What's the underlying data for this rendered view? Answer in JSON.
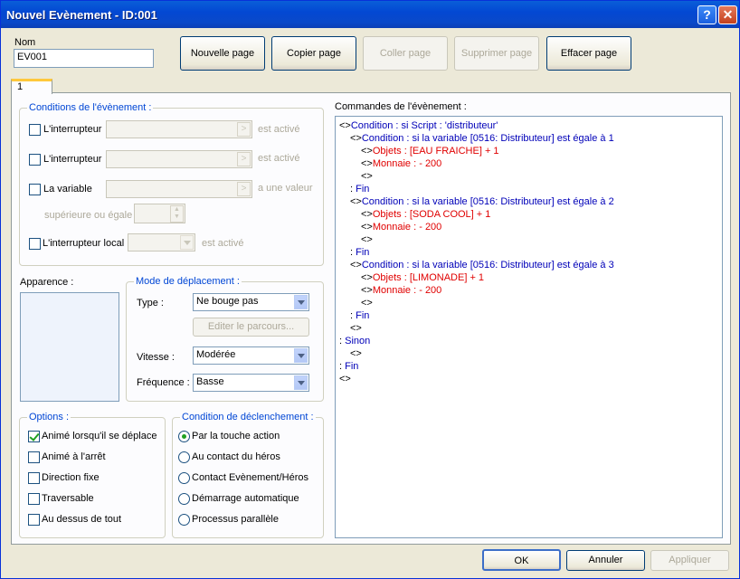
{
  "window": {
    "title": "Nouvel Evènement - ID:001",
    "help_label": "?",
    "close_label": "✕"
  },
  "name": {
    "label": "Nom",
    "value": "EV001"
  },
  "page_buttons": {
    "new_page": "Nouvelle page",
    "copy_page": "Copier page",
    "paste_page": "Coller page",
    "delete_page": "Supprimer page",
    "clear_page": "Effacer page"
  },
  "tabs": [
    {
      "label": "1"
    }
  ],
  "conditions": {
    "legend": "Conditions de l'évènement :",
    "switch1": {
      "label": "L'interrupteur",
      "suffix": "est activé"
    },
    "switch2": {
      "label": "L'interrupteur",
      "suffix": "est activé"
    },
    "variable": {
      "label": "La variable",
      "suffix": "a une valeur",
      "compare": "supérieure ou égale"
    },
    "local_switch": {
      "label": "L'interrupteur local",
      "suffix": "est activé"
    }
  },
  "appearance": {
    "label": "Apparence :"
  },
  "movement": {
    "legend": "Mode de déplacement :",
    "type_label": "Type :",
    "type_value": "Ne bouge pas",
    "edit_route": "Editer le parcours...",
    "speed_label": "Vitesse :",
    "speed_value": "Modérée",
    "freq_label": "Fréquence :",
    "freq_value": "Basse"
  },
  "options": {
    "legend": "Options :",
    "items": [
      {
        "label": "Animé lorsqu'il se déplace",
        "checked": true
      },
      {
        "label": "Animé à l'arrêt",
        "checked": false
      },
      {
        "label": "Direction fixe",
        "checked": false
      },
      {
        "label": "Traversable",
        "checked": false
      },
      {
        "label": "Au dessus de tout",
        "checked": false
      }
    ]
  },
  "trigger": {
    "legend": "Condition de déclenchement :",
    "items": [
      {
        "label": "Par la touche action",
        "selected": true
      },
      {
        "label": "Au contact du héros",
        "selected": false
      },
      {
        "label": "Contact Evènement/Héros",
        "selected": false
      },
      {
        "label": "Démarrage automatique",
        "selected": false
      },
      {
        "label": "Processus parallèle",
        "selected": false
      }
    ]
  },
  "commands": {
    "label": "Commandes de l'évènement :",
    "lines": [
      {
        "indent": 0,
        "prefix": "<>",
        "text": "Condition : si Script : 'distributeur'",
        "color": "blue"
      },
      {
        "indent": 1,
        "prefix": "<>",
        "text": "Condition : si la variable [0516: Distributeur] est égale à 1",
        "color": "blue"
      },
      {
        "indent": 2,
        "prefix": "<>",
        "text": "Objets : [EAU FRAICHE] + 1",
        "color": "red"
      },
      {
        "indent": 2,
        "prefix": "<>",
        "text": "Monnaie : - 200",
        "color": "red"
      },
      {
        "indent": 2,
        "prefix": "<>",
        "text": "",
        "color": "black"
      },
      {
        "indent": 1,
        "prefix": ": ",
        "text": "Fin",
        "color": "blue"
      },
      {
        "indent": 1,
        "prefix": "<>",
        "text": "Condition : si la variable [0516: Distributeur] est égale à 2",
        "color": "blue"
      },
      {
        "indent": 2,
        "prefix": "<>",
        "text": "Objets : [SODA COOL] + 1",
        "color": "red"
      },
      {
        "indent": 2,
        "prefix": "<>",
        "text": "Monnaie : - 200",
        "color": "red"
      },
      {
        "indent": 2,
        "prefix": "<>",
        "text": "",
        "color": "black"
      },
      {
        "indent": 1,
        "prefix": ": ",
        "text": "Fin",
        "color": "blue"
      },
      {
        "indent": 1,
        "prefix": "<>",
        "text": "Condition : si la variable [0516: Distributeur] est égale à 3",
        "color": "blue"
      },
      {
        "indent": 2,
        "prefix": "<>",
        "text": "Objets : [LIMONADE] + 1",
        "color": "red"
      },
      {
        "indent": 2,
        "prefix": "<>",
        "text": "Monnaie : - 200",
        "color": "red"
      },
      {
        "indent": 2,
        "prefix": "<>",
        "text": "",
        "color": "black"
      },
      {
        "indent": 1,
        "prefix": ": ",
        "text": "Fin",
        "color": "blue"
      },
      {
        "indent": 1,
        "prefix": "<>",
        "text": "",
        "color": "black"
      },
      {
        "indent": 0,
        "prefix": ": ",
        "text": "Sinon",
        "color": "blue"
      },
      {
        "indent": 1,
        "prefix": "<>",
        "text": "",
        "color": "black"
      },
      {
        "indent": 0,
        "prefix": ": ",
        "text": "Fin",
        "color": "blue"
      },
      {
        "indent": -1,
        "prefix": "<>",
        "text": "",
        "color": "black"
      }
    ]
  },
  "footer": {
    "ok": "OK",
    "cancel": "Annuler",
    "apply": "Appliquer"
  },
  "colors": {
    "command_blue": "#0000b8",
    "command_red": "#e00000",
    "title_bar": "#0348d3",
    "legend_blue": "#0046d5"
  }
}
